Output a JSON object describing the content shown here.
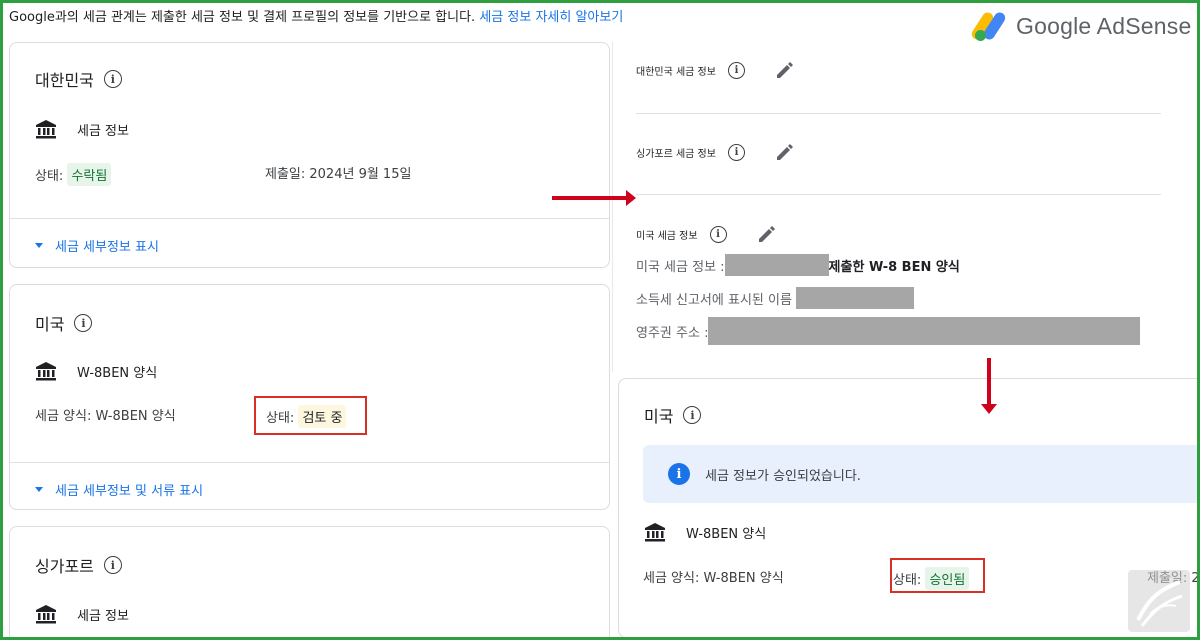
{
  "notice": {
    "text": "Google과의 세금 관계는 제출한 세금 정보 및 결제 프로필의 정보를 기반으로 합니다.",
    "link": "세금 정보 자세히 알아보기"
  },
  "logo": {
    "text": "Google AdSense"
  },
  "left": {
    "korea": {
      "title": "대한민국",
      "item": "세금 정보",
      "status_label": "상태:",
      "status_value": "수락됨",
      "submitted": "제출일: 2024년 9월 15일",
      "expand": "세금 세부정보 표시"
    },
    "usa": {
      "title": "미국",
      "item": "W-8BEN 양식",
      "form_type": "세금 양식: W-8BEN 양식",
      "status_label": "상태:",
      "status_value": "검토 중",
      "expand": "세금 세부정보 및 서류 표시"
    },
    "singapore": {
      "title": "싱가포르",
      "item": "세금 정보"
    }
  },
  "right": {
    "kr_head": "대한민국 세금 정보",
    "sg_head": "싱가포르 세금 정보",
    "us_head": "미국 세금 정보",
    "us_tax_label": "미국 세금 정보 :",
    "us_tax_value": "제출한 W-8 BEN 양식",
    "name_label": "소득세 신고서에 표시된 이름",
    "addr_label": "영주권 주소 :",
    "card": {
      "title": "미국",
      "banner": "세금 정보가 승인되었습니다.",
      "item": "W-8BEN 양식",
      "form_type": "세금 양식: W-8BEN 양식",
      "status_label": "상태:",
      "status_value": "승인됨",
      "submitted_partial": "제출일: 2"
    }
  },
  "icons": [
    "info-icon",
    "bank-icon",
    "pencil-icon",
    "triangle-down-icon",
    "arrow-right-icon",
    "arrow-down-icon"
  ],
  "colors": {
    "accent": "#1a73e8",
    "highlight_box": "#d93025",
    "arrow": "#d0021b",
    "frame": "#2e9e3f"
  }
}
